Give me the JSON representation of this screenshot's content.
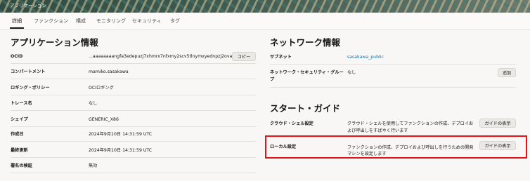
{
  "banner": {
    "title": "アプリケーション"
  },
  "tabs": [
    {
      "label": "詳細"
    },
    {
      "label": "ファンクション"
    },
    {
      "label": "構成"
    },
    {
      "label": "モニタリング"
    },
    {
      "label": "セキュリティ"
    },
    {
      "label": "タグ"
    }
  ],
  "app_info": {
    "title": "アプリケーション情報",
    "rows": [
      {
        "label": "OCID",
        "value": "...aaaaaaaangfa3edepuzj7xhmrx7nfxmy2scv5tlnymxyednpzj2ovaj7hlbq",
        "action": "コピー"
      },
      {
        "label": "コンパートメント",
        "value": "mamiko.sasakawa"
      },
      {
        "label": "ロギング・ポリシー",
        "value": "OCIロギング"
      },
      {
        "label": "トレース名",
        "value": "なし"
      },
      {
        "label": "シェイプ",
        "value": "GENERIC_X86"
      },
      {
        "label": "作成日",
        "value": "2024年9月10日 14:31:59 UTC"
      },
      {
        "label": "最終更新",
        "value": "2024年9月10日 14:31:59 UTC"
      },
      {
        "label": "署名の検証",
        "value": "無効"
      }
    ]
  },
  "network": {
    "title": "ネットワーク情報",
    "subnet_label": "サブネット",
    "subnet_value": "sasakawa_public",
    "nsg_label_line1": "ネットワーク・セキュリティ・グルー",
    "nsg_label_line2": "プ",
    "nsg_value": "なし",
    "nsg_action": "追加"
  },
  "start_guide": {
    "title": "スタート・ガイド",
    "rows": [
      {
        "label": "クラウド・シェル設定",
        "desc_line1": "クラウド・シェルを使用してファンクションの作成、デプロイお",
        "desc_line2": "よび呼出しをすばやく行います",
        "action": "ガイドの表示"
      },
      {
        "label": "ローカル設定",
        "desc_line1": "ファンクションの作成、デプロイおよび呼出しを行うための開発",
        "desc_line2": "マシンを設定します",
        "action": "ガイドの表示"
      }
    ]
  }
}
